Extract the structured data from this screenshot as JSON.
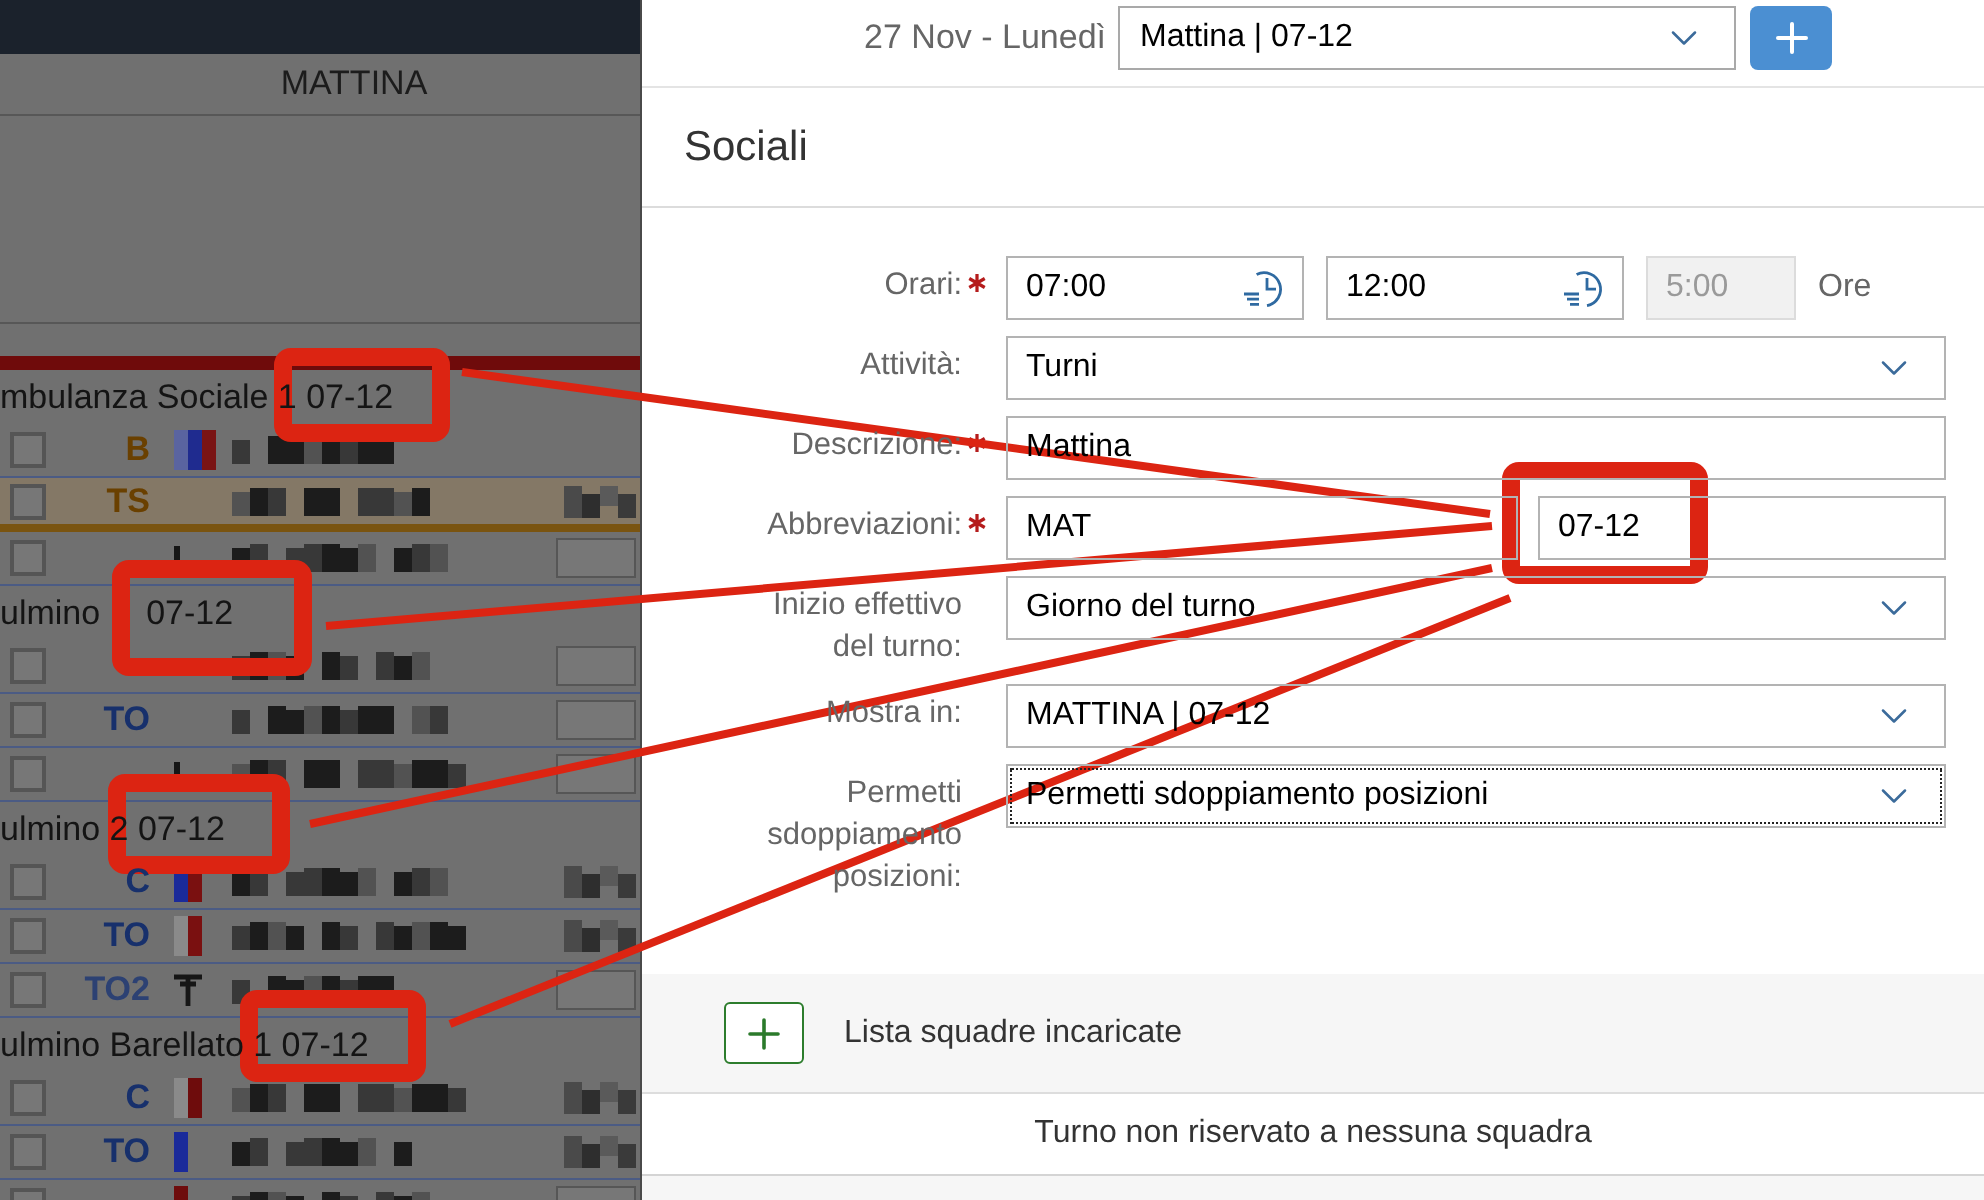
{
  "schedule": {
    "column_header": "MATTINA",
    "groups": [
      {
        "title": [
          "mbulanza Sociale 1 07-12"
        ],
        "rows": [
          {
            "code": "B",
            "color": "#6a4000",
            "checked": false,
            "highlighted": false,
            "markers": [
              {
                "color": "#5a64a0"
              },
              {
                "color": "#1f2b8f"
              },
              {
                "color": "#7a1414"
              }
            ]
          },
          {
            "code": "TS",
            "color": "#6a4000",
            "checked": false,
            "highlighted": true,
            "side": {
              "kind": "redacted"
            }
          },
          {
            "checked": false,
            "highlighted": false,
            "symbol": {
              "kind": "bar"
            },
            "side": {
              "kind": "field"
            }
          }
        ]
      },
      {
        "title": [
          "ulmino",
          "07-12"
        ],
        "rows": [
          {
            "checked": false,
            "highlighted": false,
            "side": {
              "kind": "field"
            }
          },
          {
            "code": "TO",
            "color": "#17306c",
            "checked": false,
            "highlighted": false,
            "side": {
              "kind": "field"
            }
          },
          {
            "checked": false,
            "highlighted": false,
            "symbol": {
              "kind": "bar"
            },
            "side": {
              "kind": "field"
            }
          }
        ]
      },
      {
        "title": [
          "ulmino 2 07-12"
        ],
        "rows": [
          {
            "code": "C",
            "color": "#17306c",
            "checked": false,
            "highlighted": false,
            "markers": [
              {
                "color": "#1a2a9a"
              },
              {
                "color": "#7a1010"
              }
            ],
            "side": {
              "kind": "redacted"
            }
          },
          {
            "code": "TO",
            "color": "#17306c",
            "checked": false,
            "highlighted": false,
            "markers": [
              {
                "color": "#8a8a8a"
              },
              {
                "color": "#7a1010"
              }
            ],
            "side": {
              "kind": "redacted"
            }
          },
          {
            "code": "TO2",
            "color": "#2c4173",
            "checked": false,
            "highlighted": false,
            "symbol": {
              "kind": "cross"
            },
            "side": {
              "kind": "field"
            }
          }
        ]
      },
      {
        "title": [
          "ulmino Barellato 1 07-12"
        ],
        "rows": [
          {
            "code": "C",
            "color": "#17306c",
            "checked": false,
            "highlighted": false,
            "markers": [
              {
                "color": "#8a8a8a"
              },
              {
                "color": "#6e0c0c"
              }
            ],
            "side": {
              "kind": "redacted"
            }
          },
          {
            "code": "TO",
            "color": "#17306c",
            "checked": false,
            "highlighted": false,
            "markers": [
              {
                "color": "#1a2a9a"
              }
            ],
            "side": {
              "kind": "redacted"
            }
          },
          {
            "checked": false,
            "highlighted": false,
            "markers": [
              {
                "color": "#6e0c0c"
              }
            ],
            "side": {
              "kind": "field"
            }
          }
        ]
      }
    ]
  },
  "toolbar": {
    "date": "27 Nov - Lunedì",
    "shift_select": {
      "value": "Mattina | 07-12"
    }
  },
  "section_title": "Sociali",
  "form": {
    "fields": [
      {
        "kind": "time_range",
        "label": "Orari:",
        "required": true,
        "start": "07:00",
        "end": "12:00",
        "duration": "5:00",
        "duration_disabled": true,
        "unit": "Ore"
      },
      {
        "kind": "select",
        "label": "Attività:",
        "required": false,
        "value": "Turni",
        "focused": false
      },
      {
        "kind": "text",
        "label": "Descrizione:",
        "required": true,
        "value": "Mattina"
      },
      {
        "kind": "text_pair",
        "label": "Abbreviazioni:",
        "required": true,
        "values": [
          "MAT",
          "07-12"
        ]
      },
      {
        "kind": "select",
        "label": "Inizio effettivo del turno:",
        "required": false,
        "value": "Giorno del turno",
        "focused": false
      },
      {
        "kind": "select",
        "label": "Mostra in:",
        "required": false,
        "value": "MATTINA | 07-12",
        "focused": false
      },
      {
        "kind": "select",
        "label": "Permetti sdoppiamento posizioni:",
        "required": false,
        "value": "Permetti sdoppiamento posizioni",
        "focused": true
      }
    ]
  },
  "teams": {
    "title": "Lista squadre incaricate",
    "empty_message": "Turno non riservato a nessuna squadra"
  }
}
